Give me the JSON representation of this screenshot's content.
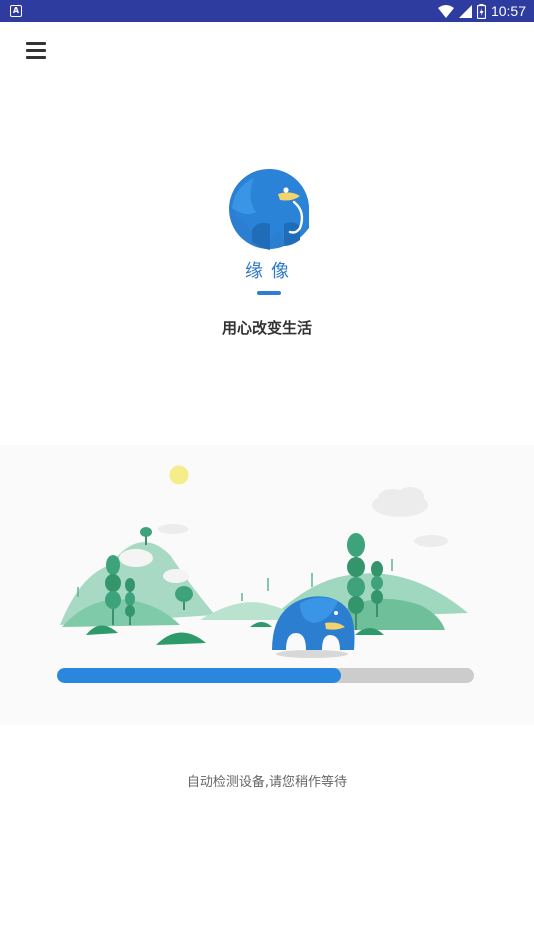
{
  "status_bar": {
    "time": "10:57",
    "left_icon": "A",
    "icons": [
      "wifi-icon",
      "cell-signal-icon",
      "battery-icon"
    ],
    "background": "#2f3c9f"
  },
  "header": {
    "menu_icon": "hamburger-menu-icon"
  },
  "brand": {
    "name": "缘像",
    "slogan": "用心改变生活",
    "accent": "#2c78c6"
  },
  "progress": {
    "value": 0.68,
    "fill_color": "#2a87dd",
    "track_color": "#cccccc"
  },
  "status_message": "自动检测设备,请您稍作等待"
}
